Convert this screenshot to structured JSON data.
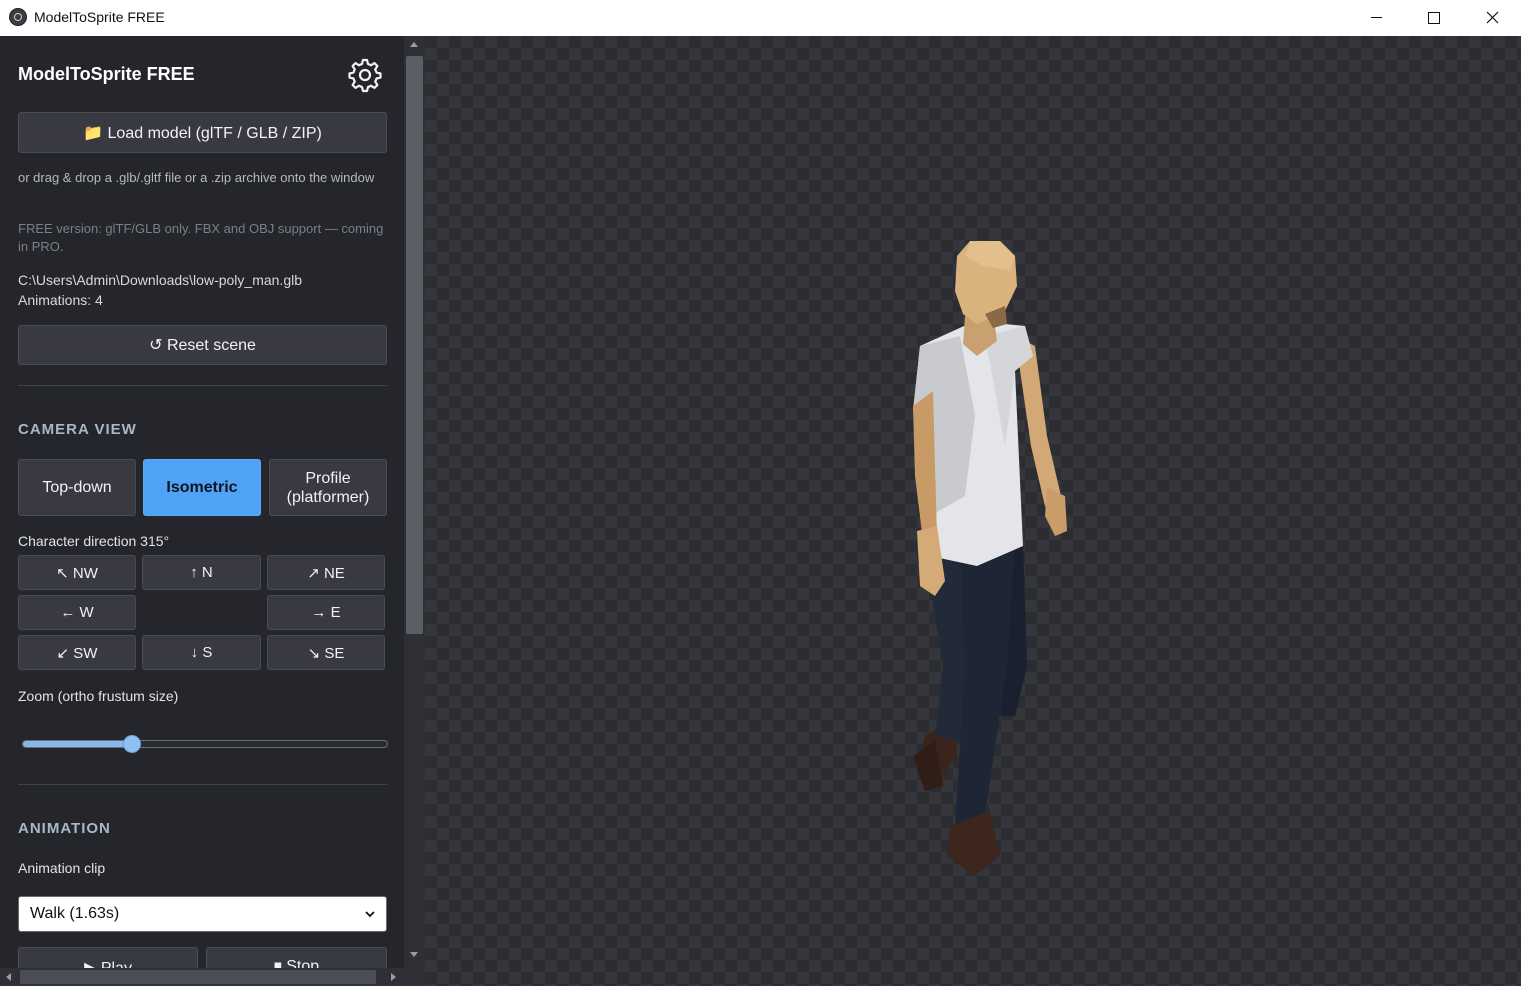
{
  "window": {
    "title": "ModelToSprite FREE"
  },
  "sidebar": {
    "brand": "ModelToSprite FREE",
    "load_button": "📁 Load model (glTF / GLB / ZIP)",
    "drop_hint": "or drag & drop a .glb/.gltf file or a .zip archive onto the window",
    "free_note": "FREE version: glTF/GLB only. FBX and OBJ support — coming in PRO.",
    "file_path": "C:\\Users\\Admin\\Downloads\\low-poly_man.glb",
    "animations_count": "Animations: 4",
    "reset_button": "↺ Reset scene",
    "camera_section": "CAMERA VIEW",
    "camera_views": {
      "topdown": "Top-down",
      "isometric": "Isometric",
      "profile_line1": "Profile",
      "profile_line2": "(platformer)"
    },
    "active_view": "Isometric",
    "direction_label": "Character direction 315°",
    "directions": {
      "nw": "↖ NW",
      "n": "↑ N",
      "ne": "↗ NE",
      "w": "← W",
      "e": "→ E",
      "sw": "↙ SW",
      "s": "↓ S",
      "se": "↘ SE"
    },
    "zoom_label": "Zoom (ortho frustum size)",
    "zoom_value_fraction": 0.3,
    "animation_section": "ANIMATION",
    "clip_label": "Animation clip",
    "clip_selected": "Walk (1.63s)",
    "play_button": "▶ Play",
    "stop_button": "⏹ Stop"
  },
  "colors": {
    "accent": "#4fa2f5",
    "sidebar_bg": "#25262b",
    "button_bg": "#393a41"
  },
  "icons": {
    "settings": "gear-icon",
    "app": "app-logo-icon",
    "select": "chevron-down-icon"
  }
}
